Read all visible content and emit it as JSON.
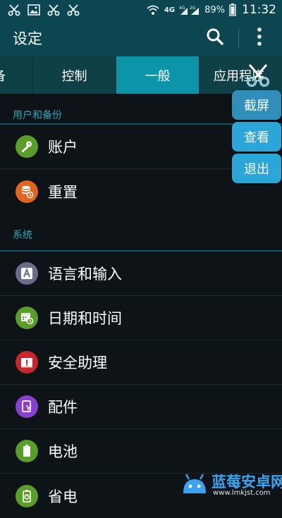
{
  "status_bar": {
    "left_icons": [
      "scissors-icon",
      "image-icon",
      "scissors-icon",
      "scissors-icon"
    ],
    "network_1": "4G",
    "network_2": "4G",
    "network_3": "2G",
    "battery_percent": "89%",
    "time": "11:32"
  },
  "header": {
    "title": "设定"
  },
  "tabs": [
    {
      "label": "备",
      "active": false
    },
    {
      "label": "控制",
      "active": false
    },
    {
      "label": "一般",
      "active": true
    },
    {
      "label": "应用程序",
      "active": false
    }
  ],
  "sections": [
    {
      "title": "用户和备份",
      "items": [
        {
          "label": "账户",
          "icon": "key-icon",
          "color": "#5a9e2a"
        },
        {
          "label": "重置",
          "icon": "database-reset-icon",
          "color": "#e2651e"
        }
      ]
    },
    {
      "title": "系统",
      "items": [
        {
          "label": "语言和输入",
          "icon": "language-icon",
          "color": "#6a6c8c"
        },
        {
          "label": "日期和时间",
          "icon": "calendar-clock-icon",
          "color": "#5a9e2a"
        },
        {
          "label": "安全助理",
          "icon": "alert-icon",
          "color": "#c8282d"
        },
        {
          "label": "配件",
          "icon": "accessory-icon",
          "color": "#8a3fd0"
        },
        {
          "label": "电池",
          "icon": "battery-icon",
          "color": "#5a9e2a"
        },
        {
          "label": "省电",
          "icon": "power-saving-icon",
          "color": "#5a9e2a"
        }
      ]
    }
  ],
  "floating_tool": {
    "capture_label": "截屏",
    "view_label": "查看",
    "exit_label": "退出"
  },
  "watermark": {
    "title": "蓝莓安卓网",
    "url": "www.lmkjst.com"
  }
}
